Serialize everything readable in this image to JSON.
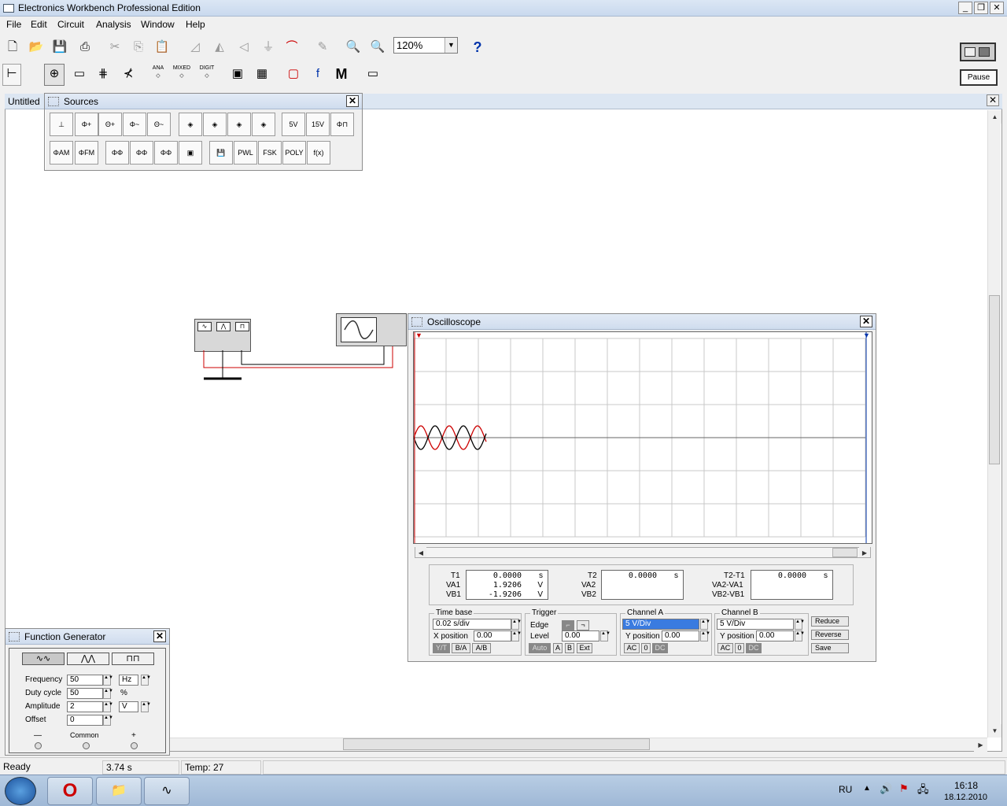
{
  "app": {
    "title": "Electronics Workbench Professional Edition"
  },
  "menu": [
    "File",
    "Edit",
    "Circuit",
    "Analysis",
    "Window",
    "Help"
  ],
  "toolbar": {
    "zoom": "120%",
    "help": "?",
    "pause_label": "Pause",
    "m_label": "M"
  },
  "parts_bin": {
    "ana": "ANA",
    "mixed": "MIXED",
    "digit": "DIGIT"
  },
  "document": {
    "title": "Untitled"
  },
  "sources_panel": {
    "title": "Sources",
    "row2_labels": [
      "PWL",
      "FSK",
      "POLY",
      "f(x)"
    ],
    "v5": "5V",
    "v15": "15V"
  },
  "oscilloscope": {
    "title": "Oscilloscope",
    "readout": {
      "t1_label": "T1",
      "t1_value": "0.0000",
      "t1_unit": "s",
      "va1_label": "VA1",
      "va1_value": "1.9206",
      "va1_unit": "V",
      "vb1_label": "VB1",
      "vb1_value": "-1.9206",
      "vb1_unit": "V",
      "t2_label": "T2",
      "t2_value": "0.0000",
      "t2_unit": "s",
      "va2_label": "VA2",
      "vb2_label": "VB2",
      "dt_label": "T2-T1",
      "dt_value": "0.0000",
      "dt_unit": "s",
      "dva_label": "VA2-VA1",
      "dvb_label": "VB2-VB1"
    },
    "timebase": {
      "label": "Time base",
      "value": "0.02 s/div",
      "xpos_label": "X position",
      "xpos": "0.00",
      "buttons": [
        "Y/T",
        "B/A",
        "A/B"
      ]
    },
    "trigger": {
      "label": "Trigger",
      "edge_label": "Edge",
      "level_label": "Level",
      "level": "0.00",
      "buttons": [
        "Auto",
        "A",
        "B",
        "Ext"
      ]
    },
    "channel_a": {
      "label": "Channel A",
      "value": "5 V/Div",
      "ypos_label": "Y position",
      "ypos": "0.00",
      "buttons": [
        "AC",
        "0",
        "DC"
      ]
    },
    "channel_b": {
      "label": "Channel B",
      "value": "5 V/Div",
      "ypos_label": "Y position",
      "ypos": "0.00",
      "buttons": [
        "AC",
        "0",
        "DC"
      ]
    },
    "side_buttons": [
      "Reduce",
      "Reverse",
      "Save"
    ],
    "trace_colors": {
      "a": "#cc0000",
      "b": "#000000"
    }
  },
  "function_generator": {
    "title": "Function Generator",
    "frequency_label": "Frequency",
    "frequency": "50",
    "frequency_unit": "Hz",
    "duty_label": "Duty cycle",
    "duty": "50",
    "duty_unit": "%",
    "amplitude_label": "Amplitude",
    "amplitude": "2",
    "amplitude_unit": "V",
    "offset_label": "Offset",
    "offset": "0",
    "minus": "—",
    "common": "Common",
    "plus": "+"
  },
  "status": {
    "ready": "Ready",
    "time": "3.74 s",
    "temp": "Temp:  27"
  },
  "taskbar": {
    "lang": "RU",
    "clock_time": "16:18",
    "clock_date": "18.12.2010"
  }
}
